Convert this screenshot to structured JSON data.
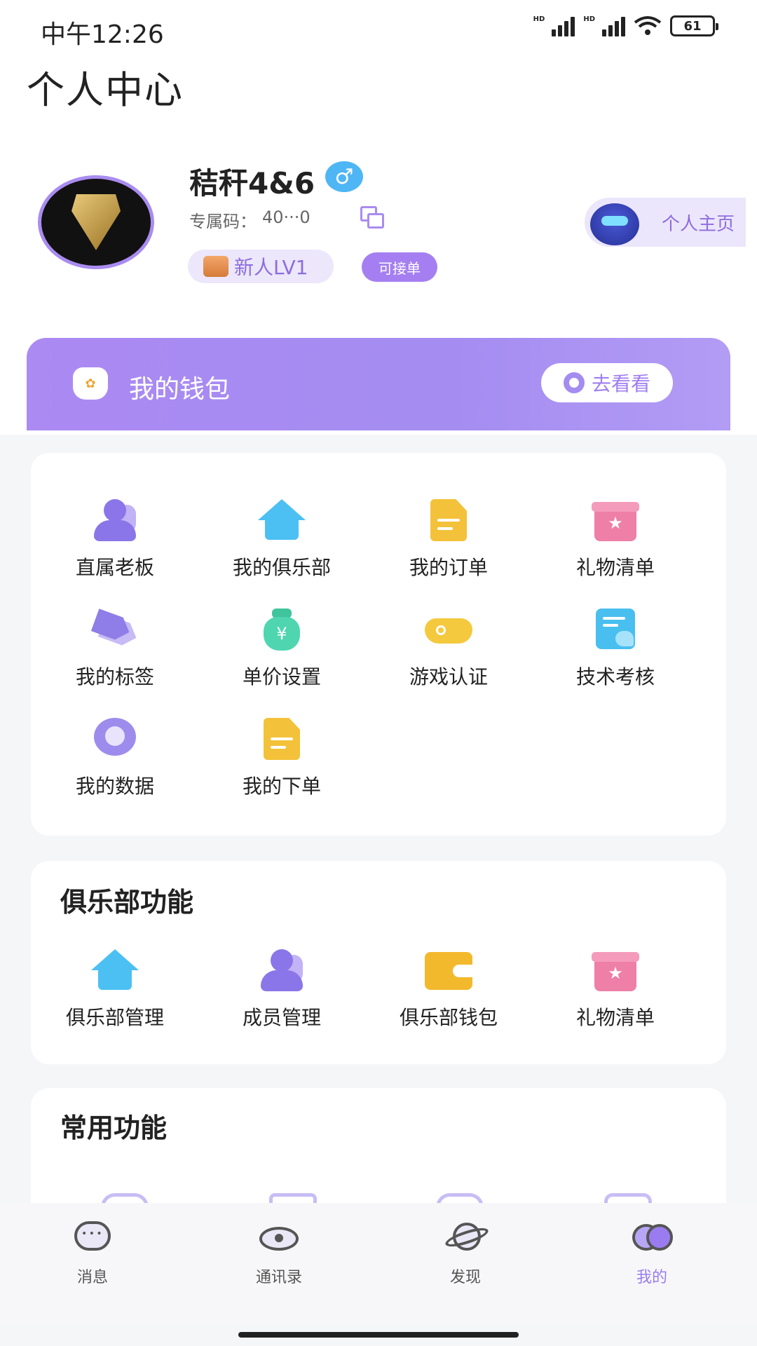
{
  "status_bar": {
    "time": "中午12:26",
    "battery": "61",
    "hd1": "HD",
    "hd2": "HD"
  },
  "header": {
    "title": "个人中心"
  },
  "profile": {
    "username": "秸秆4&6",
    "gender_symbol": "♂",
    "code_label": "专属码：",
    "code_value": "40···0",
    "level_badge": "新人LV1",
    "accept_badge": "可接单",
    "homepage_label": "个人主页"
  },
  "wallet": {
    "label": "我的钱包",
    "go_label": "去看看"
  },
  "personal_grid": [
    {
      "label": "直属老板",
      "icon": "person-icon"
    },
    {
      "label": "我的俱乐部",
      "icon": "house-icon"
    },
    {
      "label": "我的订单",
      "icon": "document-icon"
    },
    {
      "label": "礼物清单",
      "icon": "gift-icon"
    },
    {
      "label": "我的标签",
      "icon": "tag-icon"
    },
    {
      "label": "单价设置",
      "icon": "money-bag-icon"
    },
    {
      "label": "游戏认证",
      "icon": "gamepad-icon"
    },
    {
      "label": "技术考核",
      "icon": "assessment-icon"
    },
    {
      "label": "我的数据",
      "icon": "pie-chart-icon"
    },
    {
      "label": "我的下单",
      "icon": "document-icon"
    }
  ],
  "club": {
    "title": "俱乐部功能",
    "items": [
      {
        "label": "俱乐部管理",
        "icon": "house-icon"
      },
      {
        "label": "成员管理",
        "icon": "person-icon"
      },
      {
        "label": "俱乐部钱包",
        "icon": "wallet-icon"
      },
      {
        "label": "礼物清单",
        "icon": "gift-icon"
      }
    ]
  },
  "common": {
    "title": "常用功能"
  },
  "tabbar": [
    {
      "label": "消息",
      "icon": "chat-bubble-icon"
    },
    {
      "label": "通讯录",
      "icon": "contacts-eye-icon"
    },
    {
      "label": "发现",
      "icon": "planet-icon"
    },
    {
      "label": "我的",
      "icon": "mine-icon",
      "active": true
    }
  ],
  "colors": {
    "accent": "#a57ff1",
    "accent_light": "#ece6fc",
    "background": "#f5f6f8"
  }
}
